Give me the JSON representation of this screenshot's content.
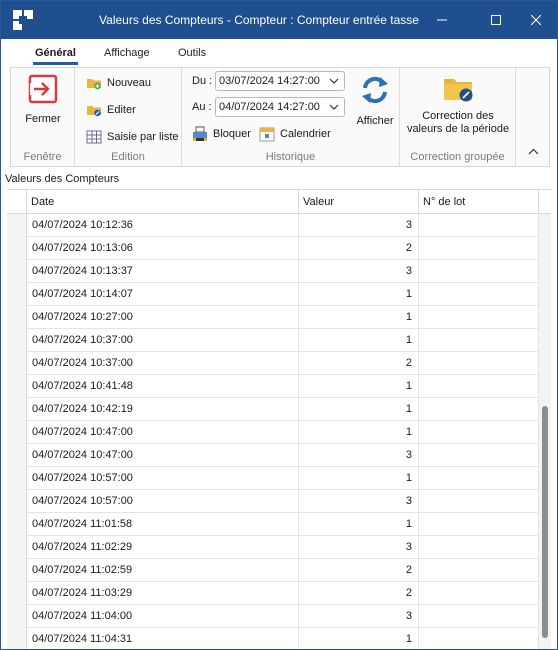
{
  "window": {
    "title": "Valeurs des Compteurs - Compteur : Compteur entrée tasse"
  },
  "tabs": [
    {
      "label": "Général"
    },
    {
      "label": "Affichage"
    },
    {
      "label": "Outils"
    }
  ],
  "ribbon": {
    "fenetre": {
      "close_label": "Fermer",
      "group_label": "Fenêtre"
    },
    "edition": {
      "new_label": "Nouveau",
      "edit_label": "Editer",
      "list_label": "Saisie par liste",
      "group_label": "Edition"
    },
    "historique": {
      "from_label": "Du :",
      "from_value": "03/07/2024 14:27:00",
      "to_label": "Au :",
      "to_value": "04/07/2024 14:27:00",
      "block_label": "Bloquer",
      "calendar_label": "Calendrier",
      "show_label": "Afficher",
      "group_label": "Historique"
    },
    "correction": {
      "button_line1": "Correction des",
      "button_line2": "valeurs de la période",
      "group_label": "Correction groupée"
    }
  },
  "panel": {
    "title": "Valeurs des Compteurs"
  },
  "grid": {
    "columns": {
      "date": "Date",
      "value": "Valeur",
      "lot": "N° de lot"
    },
    "rows": [
      {
        "date": "04/07/2024 10:12:36",
        "value": "3",
        "lot": ""
      },
      {
        "date": "04/07/2024 10:13:06",
        "value": "2",
        "lot": ""
      },
      {
        "date": "04/07/2024 10:13:37",
        "value": "3",
        "lot": ""
      },
      {
        "date": "04/07/2024 10:14:07",
        "value": "1",
        "lot": ""
      },
      {
        "date": "04/07/2024 10:27:00",
        "value": "1",
        "lot": ""
      },
      {
        "date": "04/07/2024 10:37:00",
        "value": "1",
        "lot": ""
      },
      {
        "date": "04/07/2024 10:37:00",
        "value": "2",
        "lot": ""
      },
      {
        "date": "04/07/2024 10:41:48",
        "value": "1",
        "lot": ""
      },
      {
        "date": "04/07/2024 10:42:19",
        "value": "1",
        "lot": ""
      },
      {
        "date": "04/07/2024 10:47:00",
        "value": "1",
        "lot": ""
      },
      {
        "date": "04/07/2024 10:47:00",
        "value": "3",
        "lot": ""
      },
      {
        "date": "04/07/2024 10:57:00",
        "value": "1",
        "lot": ""
      },
      {
        "date": "04/07/2024 10:57:00",
        "value": "3",
        "lot": ""
      },
      {
        "date": "04/07/2024 11:01:58",
        "value": "1",
        "lot": ""
      },
      {
        "date": "04/07/2024 11:02:29",
        "value": "3",
        "lot": ""
      },
      {
        "date": "04/07/2024 11:02:59",
        "value": "2",
        "lot": ""
      },
      {
        "date": "04/07/2024 11:03:29",
        "value": "2",
        "lot": ""
      },
      {
        "date": "04/07/2024 11:04:00",
        "value": "3",
        "lot": ""
      },
      {
        "date": "04/07/2024 11:04:31",
        "value": "1",
        "lot": ""
      }
    ]
  }
}
